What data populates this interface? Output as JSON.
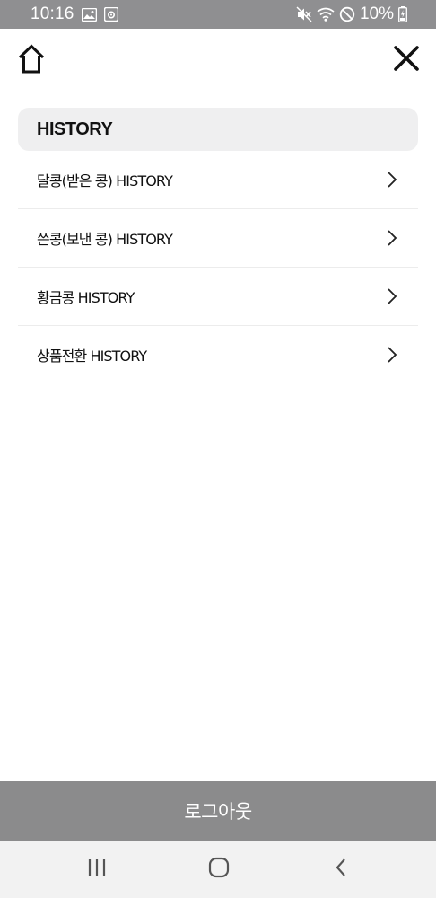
{
  "status_bar": {
    "time": "10:16",
    "battery_percent": "10%",
    "icons": [
      "image-icon",
      "app-notification-icon",
      "mute-icon",
      "wifi-icon",
      "do-not-disturb-icon",
      "battery-charging-icon"
    ]
  },
  "top_nav": {
    "home_icon": "home-icon",
    "close_icon": "close-icon"
  },
  "section": {
    "title": "HISTORY"
  },
  "menu": {
    "items": [
      {
        "label": "달콩(받은 콩) HISTORY",
        "icon": "chevron-right-icon"
      },
      {
        "label": "쓴콩(보낸 콩) HISTORY",
        "icon": "chevron-right-icon"
      },
      {
        "label": "황금콩 HISTORY",
        "icon": "chevron-right-icon"
      },
      {
        "label": "상품전환 HISTORY",
        "icon": "chevron-right-icon"
      }
    ]
  },
  "logout": {
    "label": "로그아웃"
  },
  "android_nav": {
    "icons": [
      "recent-apps-icon",
      "home-circle-icon",
      "back-icon"
    ]
  },
  "colors": {
    "status_bar_bg": "#8f8f91",
    "section_header_bg": "#efeff0",
    "logout_bg": "#8b8b8c",
    "nav_bar_bg": "#f2f2f2"
  }
}
